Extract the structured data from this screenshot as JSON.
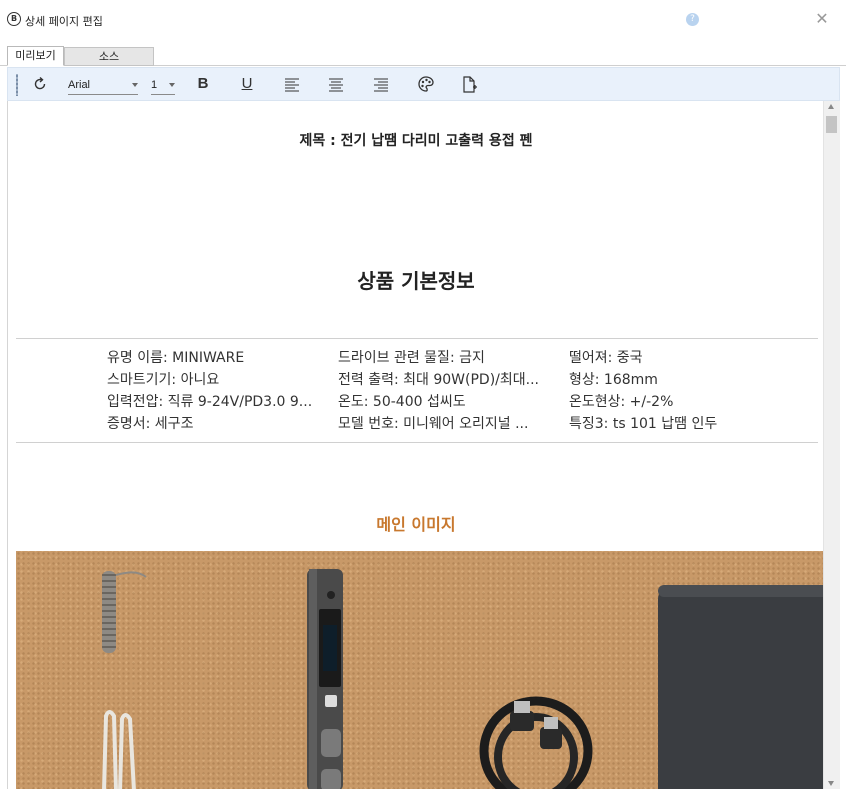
{
  "window": {
    "title": "상세 페이지 편집",
    "help_label": "?",
    "close_label": "✕",
    "app_icon_text": "B"
  },
  "tabs": [
    {
      "label": "미리보기",
      "active": true
    },
    {
      "label": "소스",
      "active": false
    }
  ],
  "toolbar": {
    "font_family_value": "Arial",
    "font_size_value": "1",
    "bold_label": "B",
    "underline_label": "U",
    "icons": [
      "refresh-icon",
      "align-left-icon",
      "align-center-icon",
      "align-right-icon",
      "palette-icon",
      "new-page-icon"
    ]
  },
  "content": {
    "subject": "제목 : 전기 납땜 다리미 고출력 용접 펜",
    "basic_info_title": "상품 기본정보",
    "specs": [
      [
        "유명 이름: MINIWARE",
        "드라이브 관련 물질: 금지",
        "떨어져: 중국"
      ],
      [
        "스마트기기: 아니요",
        "전력 출력: 최대 90W(PD)/최대...",
        "형상: 168mm"
      ],
      [
        "입력전압: 직류 9-24V/PD3.0 9...",
        "온도: 50-400 섭씨도",
        "온도현상: +/-2%"
      ],
      [
        "증명서: 세구조",
        "모델 번호: 미니웨어 오리지널 ...",
        "특징3: ts 101 납땜 인두"
      ]
    ],
    "main_image_title": "메인 이미지"
  },
  "colors": {
    "accent_orange": "#c8782e",
    "toolbar_bg": "#e9f1fb",
    "photo_bg": "#c89968"
  }
}
